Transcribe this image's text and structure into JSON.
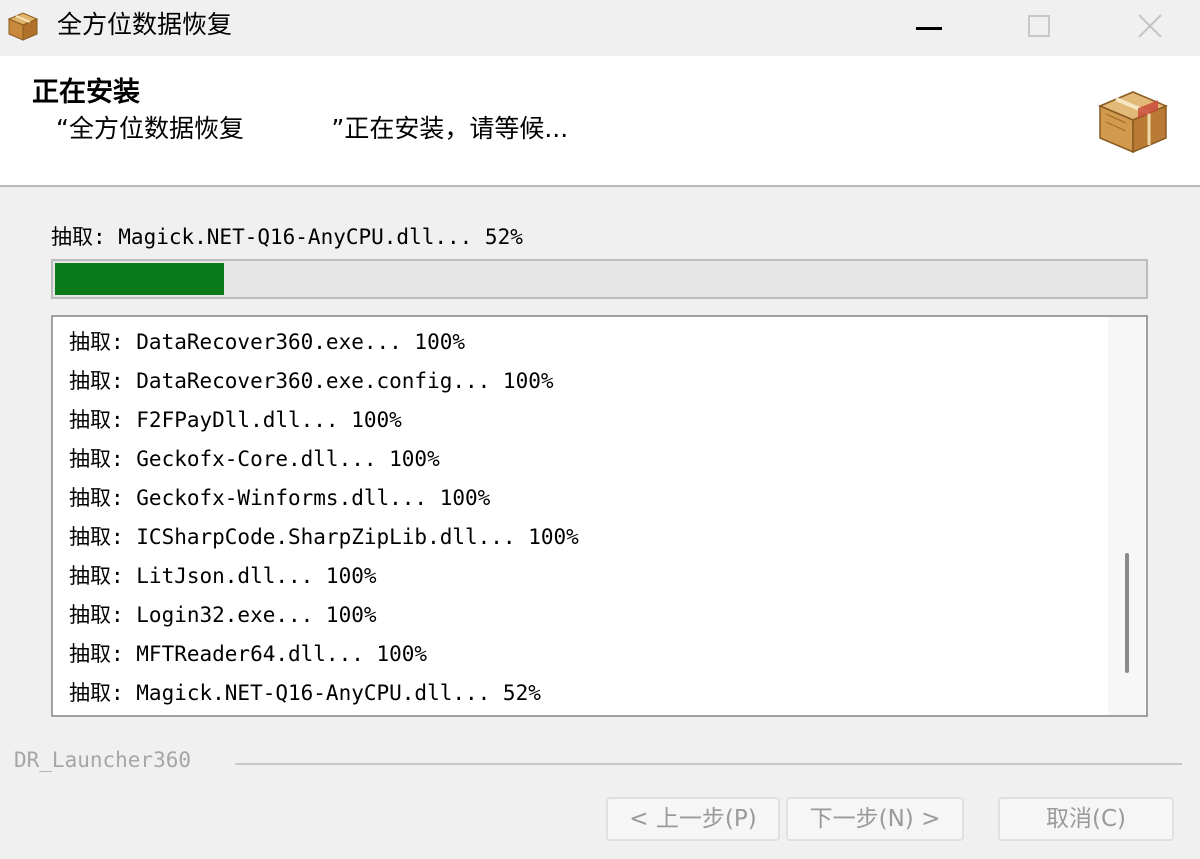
{
  "window": {
    "title": "全方位数据恢复",
    "app_icon": "package-box-icon",
    "minimize_icon": "minimize-icon",
    "maximize_icon": "maximize-icon",
    "close_icon": "close-icon"
  },
  "header": {
    "title": "正在安装",
    "subtitle": "“全方位数据恢复           ”正在安装，请等候...",
    "logo_icon": "package-box-icon"
  },
  "status": {
    "text": "抽取: Magick.NET-Q16-AnyCPU.dll... 52%",
    "progress_fraction": 0.155,
    "progress_color": "#0b7a1b"
  },
  "log": {
    "items": [
      "抽取: DataRecover360.exe... 100%",
      "抽取: DataRecover360.exe.config... 100%",
      "抽取: F2FPayDll.dll... 100%",
      "抽取: Geckofx-Core.dll... 100%",
      "抽取: Geckofx-Winforms.dll... 100%",
      "抽取: ICSharpCode.SharpZipLib.dll... 100%",
      "抽取: LitJson.dll... 100%",
      "抽取: Login32.exe... 100%",
      "抽取: MFTReader64.dll... 100%",
      "抽取: Magick.NET-Q16-AnyCPU.dll... 52%"
    ]
  },
  "footer": {
    "brand": "DR_Launcher360",
    "back_button": "< 上一步(P)",
    "next_button": "下一步(N) >",
    "cancel_button": "取消(C)"
  }
}
